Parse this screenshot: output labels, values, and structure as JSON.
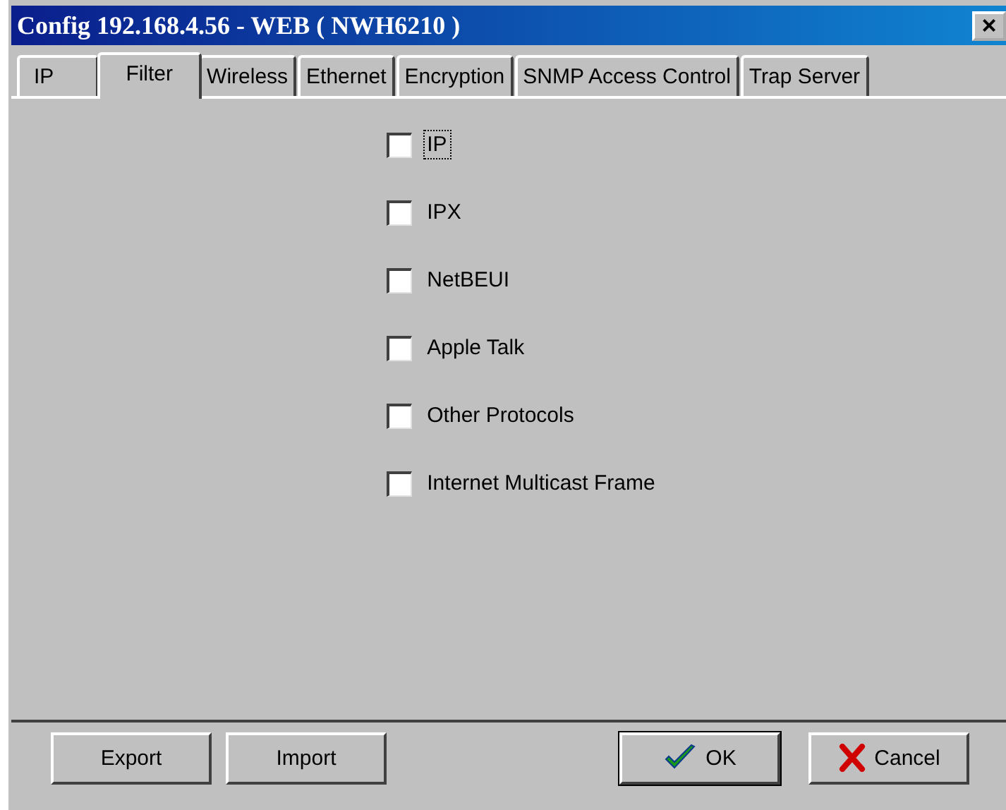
{
  "window": {
    "title": "Config 192.168.4.56 - WEB ( NWH6210 )",
    "close": "×"
  },
  "tabs": [
    {
      "label": "IP",
      "selected": false
    },
    {
      "label": "Filter",
      "selected": true
    },
    {
      "label": "Wireless",
      "selected": false
    },
    {
      "label": "Ethernet",
      "selected": false
    },
    {
      "label": "Encryption",
      "selected": false
    },
    {
      "label": "SNMP Access Control",
      "selected": false
    },
    {
      "label": "Trap Server",
      "selected": false
    }
  ],
  "filters": [
    {
      "label": "IP",
      "checked": false,
      "focused": true
    },
    {
      "label": "IPX",
      "checked": false,
      "focused": false
    },
    {
      "label": "NetBEUI",
      "checked": false,
      "focused": false
    },
    {
      "label": "Apple Talk",
      "checked": false,
      "focused": false
    },
    {
      "label": "Other Protocols",
      "checked": false,
      "focused": false
    },
    {
      "label": "Internet Multicast Frame",
      "checked": false,
      "focused": false
    }
  ],
  "buttons": [
    {
      "label": "Export",
      "kind": "plain"
    },
    {
      "label": "Import",
      "kind": "plain"
    },
    {
      "label": "OK",
      "kind": "ok"
    },
    {
      "label": "Cancel",
      "kind": "cancel"
    }
  ]
}
